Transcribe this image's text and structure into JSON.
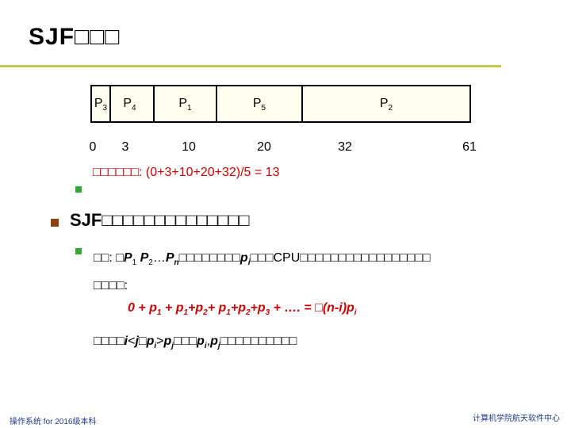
{
  "title": "SJF□□□",
  "gantt": {
    "cells": [
      {
        "name": "P",
        "sub": "3",
        "width": 3
      },
      {
        "name": "P",
        "sub": "4",
        "width": 7
      },
      {
        "name": "P",
        "sub": "1",
        "width": 10
      },
      {
        "name": "P",
        "sub": "5",
        "width": 12
      },
      {
        "name": "P",
        "sub": "2",
        "width": 29
      }
    ],
    "ticks": [
      "0",
      "3",
      "10",
      "20",
      "32",
      "61"
    ]
  },
  "avg_wait": "□□□□□□: (0+3+10+20+32)/5 = 13",
  "heading2": "SJF□□□□□□□□□□□□□□",
  "line1_prefix": "□□: □",
  "line1_suffix": "□□□□□□□□",
  "line1_tail": "□□□CPU□□□□□□□□□□□□□□□□□",
  "line2": "□□□□:",
  "formula": "0 + p₁ + p₁+p₂+ p₁+p₂+p₃ + …. = □(n-i)pᵢ",
  "line4_prefix": "□□□□",
  "line4_mid": "□□□",
  "line4_tail": "□□□□□□□□□□",
  "footer_left": "操作系统 for 2016级本科",
  "footer_right": "计算机学院航天软件中心"
}
